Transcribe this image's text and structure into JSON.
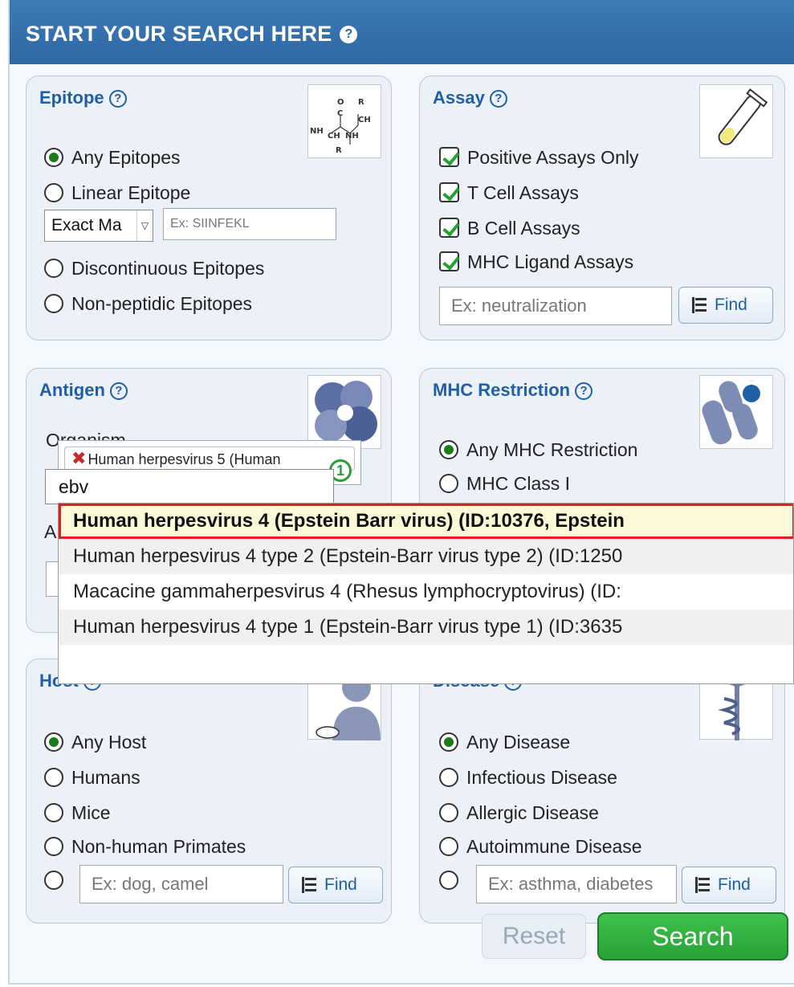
{
  "header": {
    "title": "START YOUR SEARCH HERE",
    "help": "?"
  },
  "epitope": {
    "title": "Epitope",
    "help": "?",
    "options": [
      "Any Epitopes",
      "Linear Epitope",
      "Discontinuous Epitopes",
      "Non-peptidic Epitopes"
    ],
    "selected": "Any Epitopes",
    "match_select": "Exact Ma",
    "sequence_placeholder": "Ex: SIINFEKL"
  },
  "assay": {
    "title": "Assay",
    "help": "?",
    "checks": [
      "Positive Assays Only",
      "T Cell Assays",
      "B Cell Assays",
      "MHC Ligand Assays"
    ],
    "input_placeholder": "Ex: neutralization",
    "find_label": "Find"
  },
  "antigen": {
    "title": "Antigen",
    "help": "?",
    "organism_label": "Organism",
    "antigen_label": "A",
    "selected_tag": "Human herpesvirus 5 (Human",
    "tag_count": "1",
    "search_value": "ebv",
    "suggestions": [
      "Human herpesvirus 4 (Epstein Barr virus) (ID:10376, Epstein",
      "Human herpesvirus 4 type 2 (Epstein-Barr virus type 2) (ID:1250",
      "Macacine gammaherpesvirus 4 (Rhesus lymphocryptovirus) (ID:",
      "Human herpesvirus 4 type 1 (Epstein-Barr virus type 1) (ID:3635"
    ]
  },
  "mhc": {
    "title": "MHC Restriction",
    "help": "?",
    "options": [
      "Any MHC Restriction",
      "MHC Class I"
    ],
    "selected": "Any MHC Restriction"
  },
  "host": {
    "title": "Host",
    "help": "?",
    "options": [
      "Any Host",
      "Humans",
      "Mice",
      "Non-human Primates"
    ],
    "selected": "Any Host",
    "input_placeholder": "Ex: dog, camel",
    "find_label": "Find"
  },
  "disease": {
    "title": "Disease",
    "help": "?",
    "options": [
      "Any Disease",
      "Infectious Disease",
      "Allergic Disease",
      "Autoimmune Disease"
    ],
    "selected": "Any Disease",
    "input_placeholder": "Ex: asthma, diabetes",
    "find_label": "Find"
  },
  "actions": {
    "reset": "Reset",
    "search": "Search"
  },
  "colors": {
    "brand": "#2d67a3",
    "accent_green": "#27a235",
    "highlight_border": "#e01e1e"
  }
}
